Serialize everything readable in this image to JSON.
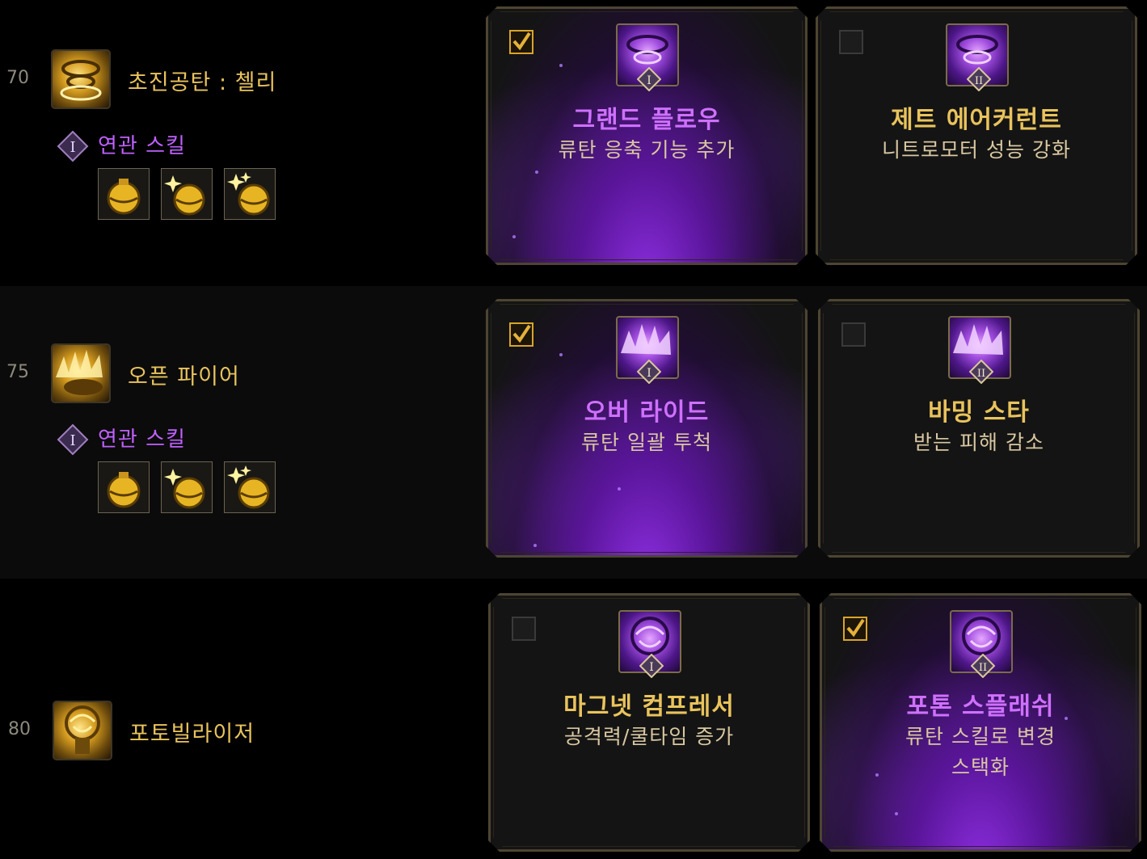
{
  "rows": [
    {
      "level": "70",
      "skill_name": "초진공탄 : 첼리",
      "related_label": "연관 스킬",
      "related_roman": "I",
      "tripods": [
        {
          "roman": "I",
          "name": "그랜드 플로우",
          "desc": [
            "류탄 응축 기능 추가"
          ],
          "selected": true
        },
        {
          "roman": "II",
          "name": "제트 에어커런트",
          "desc": [
            "니트로모터 성능 강화"
          ],
          "selected": false
        }
      ]
    },
    {
      "level": "75",
      "skill_name": "오픈 파이어",
      "related_label": "연관 스킬",
      "related_roman": "I",
      "tripods": [
        {
          "roman": "I",
          "name": "오버 라이드",
          "desc": [
            "류탄 일괄 투척"
          ],
          "selected": true
        },
        {
          "roman": "II",
          "name": "바밍 스타",
          "desc": [
            "받는 피해 감소"
          ],
          "selected": false
        }
      ]
    },
    {
      "level": "80",
      "skill_name": "포토빌라이저",
      "tripods": [
        {
          "roman": "I",
          "name": "마그넷 컴프레서",
          "desc": [
            "공격력/쿨타임 증가"
          ],
          "selected": false
        },
        {
          "roman": "II",
          "name": "포톤 스플래쉬",
          "desc": [
            "류탄 스킬로 변경",
            "스택화"
          ],
          "selected": true
        }
      ]
    }
  ],
  "icons": {
    "skill": "skill-icon",
    "related": "grenade-icon",
    "tripod": "tripod-icon",
    "check": "checkbox"
  },
  "colors": {
    "gold": "#e9c35c",
    "purple": "#cf70ff",
    "desc": "#d8c7a1",
    "level": "#8c8a7c"
  }
}
